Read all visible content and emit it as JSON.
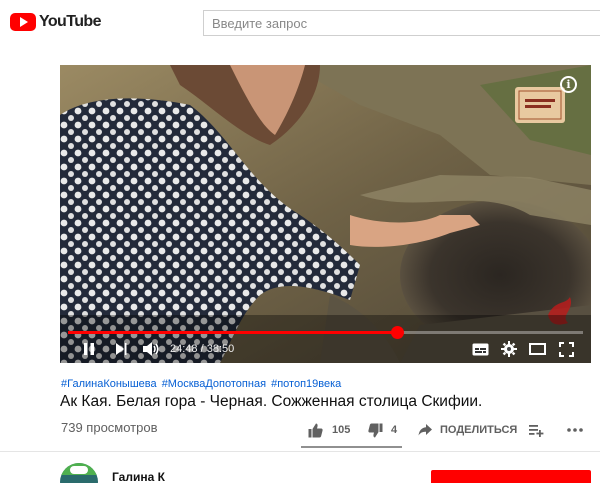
{
  "header": {
    "logo_text": "YouTube",
    "search_placeholder": "Введите запрос"
  },
  "player": {
    "time_current": "24:48",
    "time_total": "38:50",
    "time_separator": " / ",
    "progress_fraction": 0.639,
    "info_label": "i"
  },
  "video": {
    "tags": [
      "#ГалинаКонышева",
      "#МоскваДопотопная",
      "#потоп19века"
    ],
    "title": "Ак Кая. Белая гора - Черная. Сожженная столица Скифии.",
    "views": "739 просмотров"
  },
  "actions": {
    "likes": "105",
    "dislikes": "4",
    "share_label": "ПОДЕЛИТЬСЯ"
  },
  "channel": {
    "name": "Галина К"
  },
  "colors": {
    "brand_red": "#ff0000",
    "link_blue": "#065fd4",
    "muted": "#606060"
  },
  "icons": [
    "youtube-logo-icon",
    "play-pause-icon",
    "next-icon",
    "volume-icon",
    "subtitles-icon",
    "settings-gear-icon",
    "theater-mode-icon",
    "fullscreen-icon",
    "info-icon",
    "thumb-up-icon",
    "thumb-down-icon",
    "share-arrow-icon",
    "add-to-playlist-icon",
    "more-icon"
  ]
}
